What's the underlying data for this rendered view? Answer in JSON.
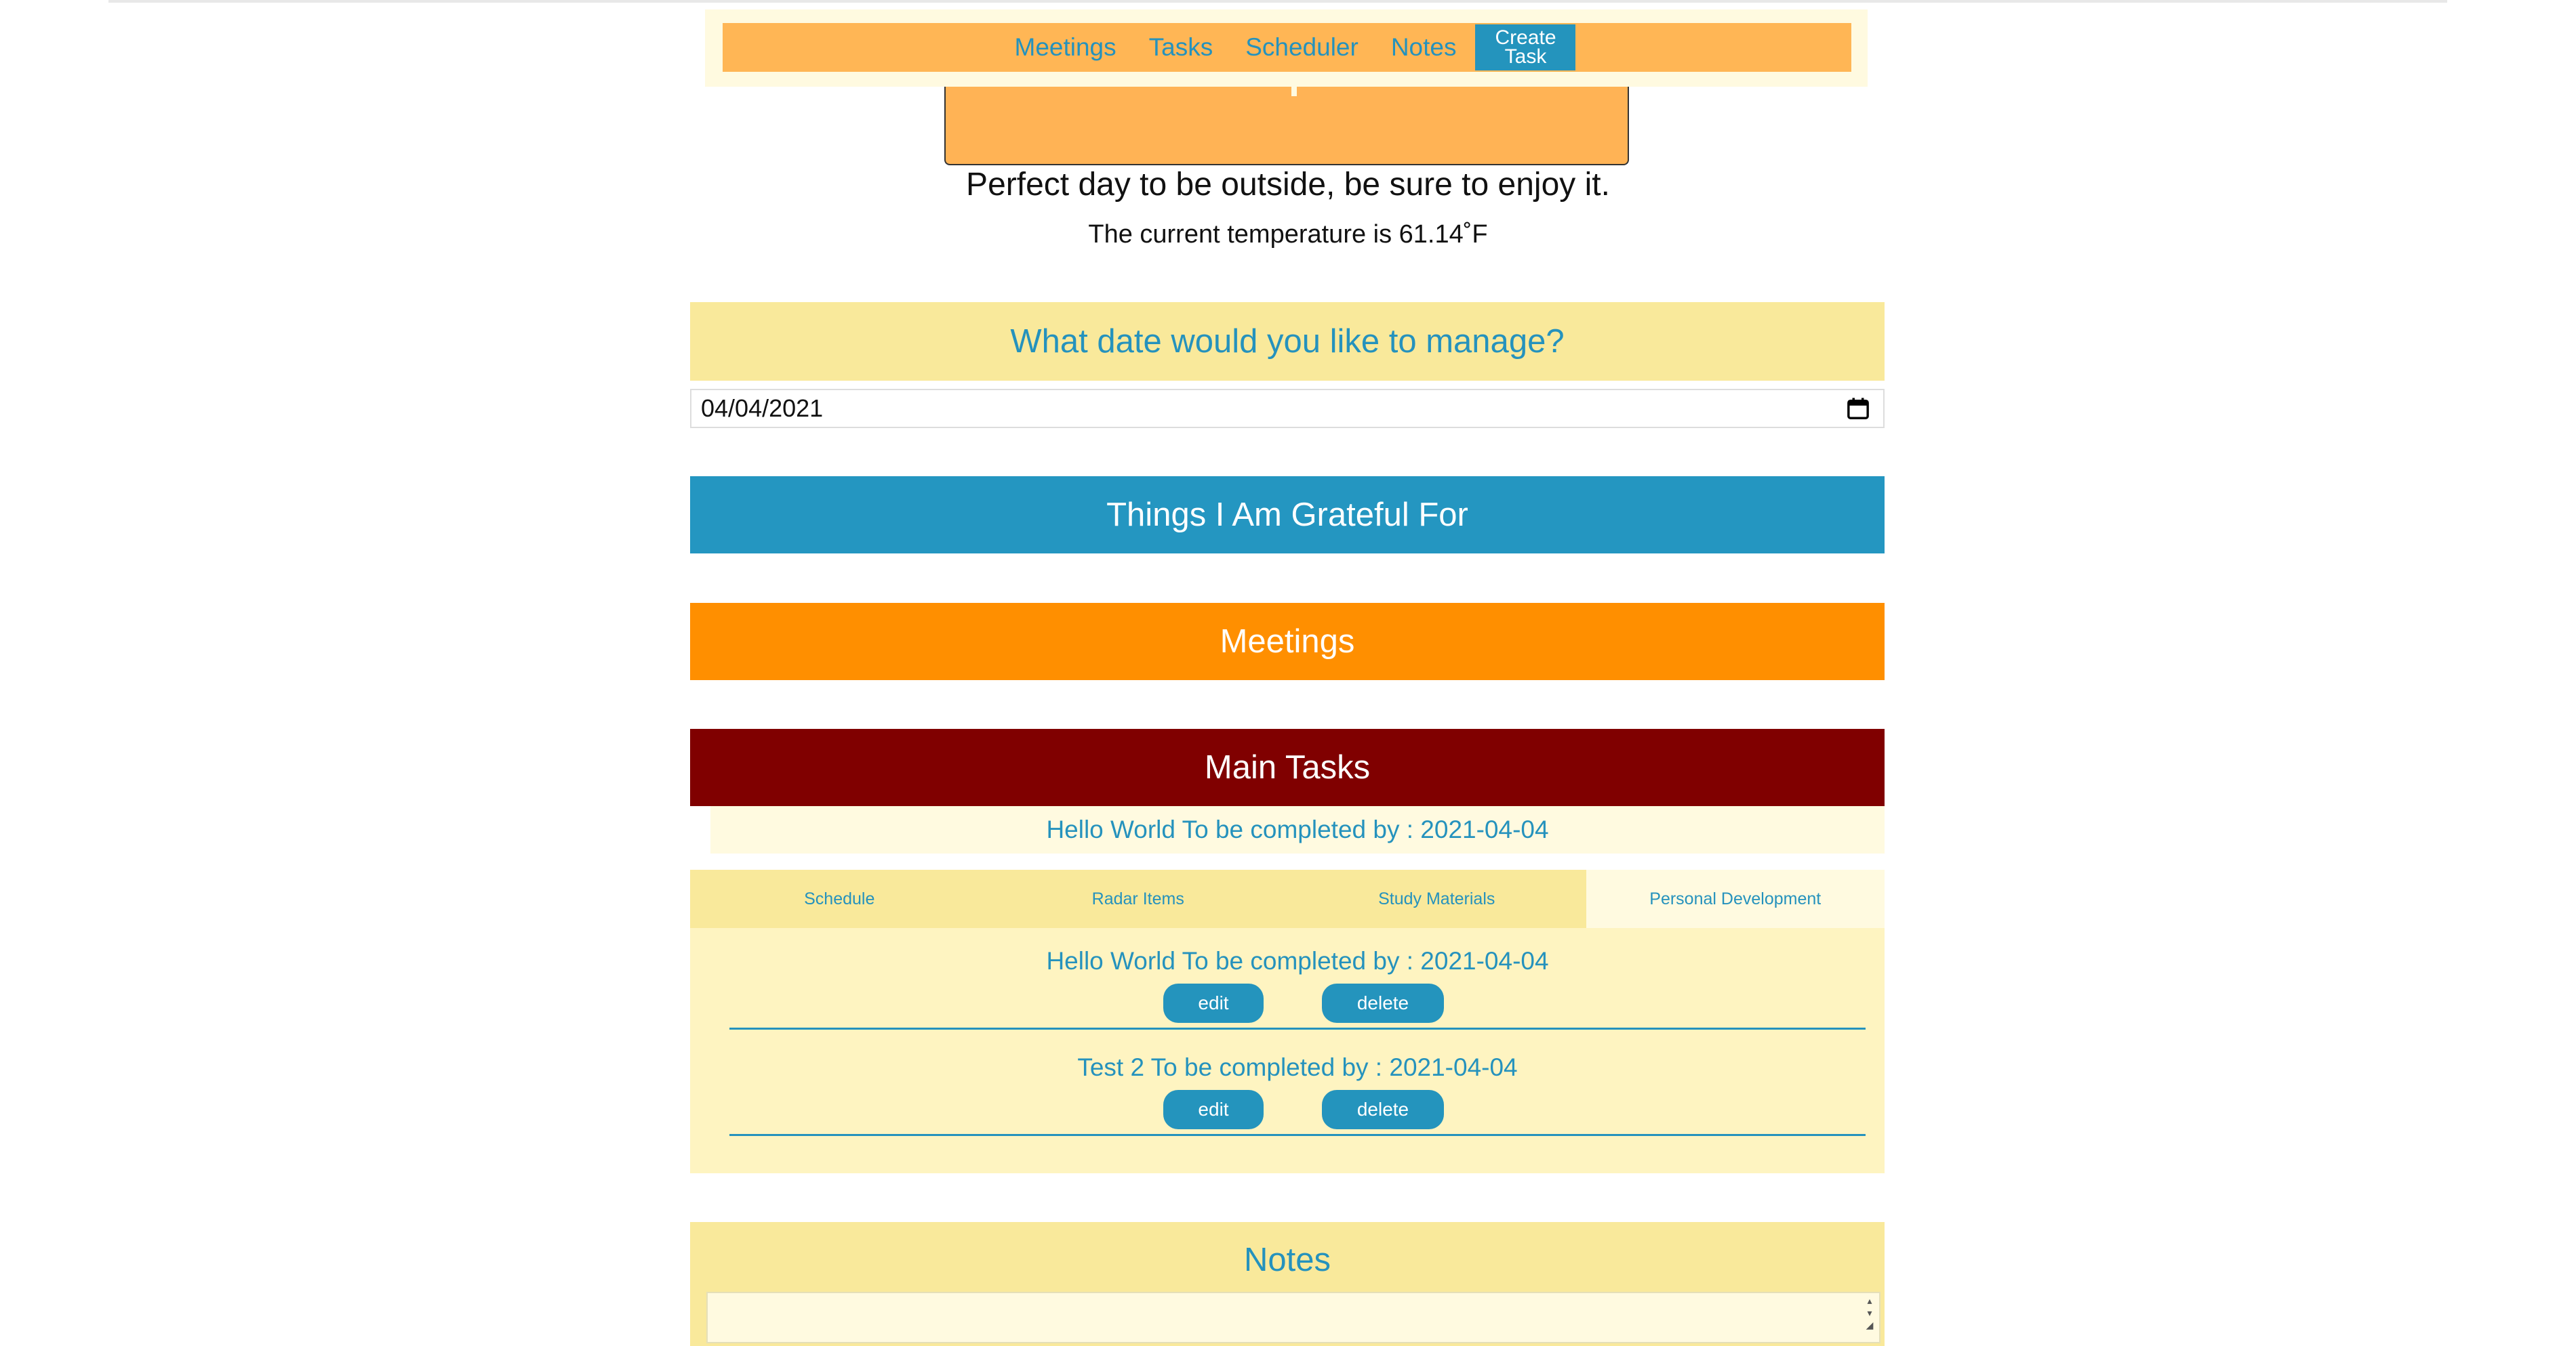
{
  "nav": {
    "links": [
      "Meetings",
      "Tasks",
      "Scheduler",
      "Notes"
    ],
    "create_task": "Create Task"
  },
  "weather": {
    "message": "Perfect day to be outside, be sure to enjoy it.",
    "temperature": "The current temperature is 61.14˚F"
  },
  "date_section": {
    "prompt": "What date would you like to manage?",
    "value": "04/04/2021"
  },
  "sections": {
    "grateful": "Things I Am Grateful For",
    "meetings": "Meetings",
    "main_tasks": "Main Tasks"
  },
  "main_task_summary": "Hello World To be completed by : 2021-04-04",
  "tabs": [
    "Schedule",
    "Radar Items",
    "Study Materials",
    "Personal Development"
  ],
  "active_tab": "Personal Development",
  "tasks": [
    {
      "title": "Hello World To be completed by : 2021-04-04",
      "edit": "edit",
      "delete": "delete"
    },
    {
      "title": "Test 2 To be completed by : 2021-04-04",
      "edit": "edit",
      "delete": "delete"
    }
  ],
  "notes": {
    "title": "Notes",
    "value": ""
  },
  "colors": {
    "accent_blue": "#2592bd",
    "nav_orange": "#ffb655",
    "meetings_orange": "#ff8f00",
    "main_tasks_red": "#800000",
    "pale_yellow": "#f9e99b",
    "cream": "#fffae0"
  }
}
